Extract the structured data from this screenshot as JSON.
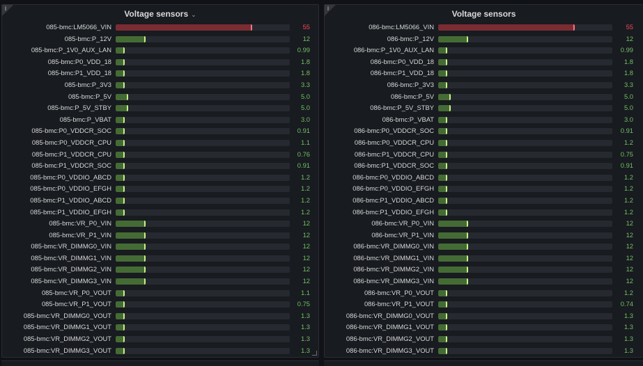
{
  "colors": {
    "ok": "#73bf69",
    "critical": "#f2495c",
    "bar_ok": "#456b35",
    "bar_critical": "#7a2c33"
  },
  "bar_max": 70,
  "panels": [
    {
      "title": "Voltage sensors",
      "has_menu": true,
      "info_icon": "i",
      "rows": [
        {
          "label": "085-bmc:LM5066_VIN",
          "value": "55",
          "status": "critical"
        },
        {
          "label": "085-bmc:P_12V",
          "value": "12",
          "status": "ok"
        },
        {
          "label": "085-bmc:P_1V0_AUX_LAN",
          "value": "0.99",
          "status": "ok"
        },
        {
          "label": "085-bmc:P0_VDD_18",
          "value": "1.8",
          "status": "ok"
        },
        {
          "label": "085-bmc:P1_VDD_18",
          "value": "1.8",
          "status": "ok"
        },
        {
          "label": "085-bmc:P_3V3",
          "value": "3.3",
          "status": "ok"
        },
        {
          "label": "085-bmc:P_5V",
          "value": "5.0",
          "status": "ok"
        },
        {
          "label": "085-bmc:P_5V_STBY",
          "value": "5.0",
          "status": "ok"
        },
        {
          "label": "085-bmc:P_VBAT",
          "value": "3.0",
          "status": "ok"
        },
        {
          "label": "085-bmc:P0_VDDCR_SOC",
          "value": "0.91",
          "status": "ok"
        },
        {
          "label": "085-bmc:P0_VDDCR_CPU",
          "value": "1.1",
          "status": "ok"
        },
        {
          "label": "085-bmc:P1_VDDCR_CPU",
          "value": "0.76",
          "status": "ok"
        },
        {
          "label": "085-bmc:P1_VDDCR_SOC",
          "value": "0.91",
          "status": "ok"
        },
        {
          "label": "085-bmc:P0_VDDIO_ABCD",
          "value": "1.2",
          "status": "ok"
        },
        {
          "label": "085-bmc:P0_VDDIO_EFGH",
          "value": "1.2",
          "status": "ok"
        },
        {
          "label": "085-bmc:P1_VDDIO_ABCD",
          "value": "1.2",
          "status": "ok"
        },
        {
          "label": "085-bmc:P1_VDDIO_EFGH",
          "value": "1.2",
          "status": "ok"
        },
        {
          "label": "085-bmc:VR_P0_VIN",
          "value": "12",
          "status": "ok"
        },
        {
          "label": "085-bmc:VR_P1_VIN",
          "value": "12",
          "status": "ok"
        },
        {
          "label": "085-bmc:VR_DIMMG0_VIN",
          "value": "12",
          "status": "ok"
        },
        {
          "label": "085-bmc:VR_DIMMG1_VIN",
          "value": "12",
          "status": "ok"
        },
        {
          "label": "085-bmc:VR_DIMMG2_VIN",
          "value": "12",
          "status": "ok"
        },
        {
          "label": "085-bmc:VR_DIMMG3_VIN",
          "value": "12",
          "status": "ok"
        },
        {
          "label": "085-bmc:VR_P0_VOUT",
          "value": "1.1",
          "status": "ok"
        },
        {
          "label": "085-bmc:VR_P1_VOUT",
          "value": "0.75",
          "status": "ok"
        },
        {
          "label": "085-bmc:VR_DIMMG0_VOUT",
          "value": "1.3",
          "status": "ok"
        },
        {
          "label": "085-bmc:VR_DIMMG1_VOUT",
          "value": "1.3",
          "status": "ok"
        },
        {
          "label": "085-bmc:VR_DIMMG2_VOUT",
          "value": "1.3",
          "status": "ok"
        },
        {
          "label": "085-bmc:VR_DIMMG3_VOUT",
          "value": "1.3",
          "status": "ok"
        }
      ]
    },
    {
      "title": "Voltage sensors",
      "has_menu": false,
      "info_icon": "i",
      "rows": [
        {
          "label": "086-bmc:LM5066_VIN",
          "value": "55",
          "status": "critical"
        },
        {
          "label": "086-bmc:P_12V",
          "value": "12",
          "status": "ok"
        },
        {
          "label": "086-bmc:P_1V0_AUX_LAN",
          "value": "0.99",
          "status": "ok"
        },
        {
          "label": "086-bmc:P0_VDD_18",
          "value": "1.8",
          "status": "ok"
        },
        {
          "label": "086-bmc:P1_VDD_18",
          "value": "1.8",
          "status": "ok"
        },
        {
          "label": "086-bmc:P_3V3",
          "value": "3.3",
          "status": "ok"
        },
        {
          "label": "086-bmc:P_5V",
          "value": "5.0",
          "status": "ok"
        },
        {
          "label": "086-bmc:P_5V_STBY",
          "value": "5.0",
          "status": "ok"
        },
        {
          "label": "086-bmc:P_VBAT",
          "value": "3.0",
          "status": "ok"
        },
        {
          "label": "086-bmc:P0_VDDCR_SOC",
          "value": "0.91",
          "status": "ok"
        },
        {
          "label": "086-bmc:P0_VDDCR_CPU",
          "value": "1.2",
          "status": "ok"
        },
        {
          "label": "086-bmc:P1_VDDCR_CPU",
          "value": "0.75",
          "status": "ok"
        },
        {
          "label": "086-bmc:P1_VDDCR_SOC",
          "value": "0.91",
          "status": "ok"
        },
        {
          "label": "086-bmc:P0_VDDIO_ABCD",
          "value": "1.2",
          "status": "ok"
        },
        {
          "label": "086-bmc:P0_VDDIO_EFGH",
          "value": "1.2",
          "status": "ok"
        },
        {
          "label": "086-bmc:P1_VDDIO_ABCD",
          "value": "1.2",
          "status": "ok"
        },
        {
          "label": "086-bmc:P1_VDDIO_EFGH",
          "value": "1.2",
          "status": "ok"
        },
        {
          "label": "086-bmc:VR_P0_VIN",
          "value": "12",
          "status": "ok"
        },
        {
          "label": "086-bmc:VR_P1_VIN",
          "value": "12",
          "status": "ok"
        },
        {
          "label": "086-bmc:VR_DIMMG0_VIN",
          "value": "12",
          "status": "ok"
        },
        {
          "label": "086-bmc:VR_DIMMG1_VIN",
          "value": "12",
          "status": "ok"
        },
        {
          "label": "086-bmc:VR_DIMMG2_VIN",
          "value": "12",
          "status": "ok"
        },
        {
          "label": "086-bmc:VR_DIMMG3_VIN",
          "value": "12",
          "status": "ok"
        },
        {
          "label": "086-bmc:VR_P0_VOUT",
          "value": "1.2",
          "status": "ok"
        },
        {
          "label": "086-bmc:VR_P1_VOUT",
          "value": "0.74",
          "status": "ok"
        },
        {
          "label": "086-bmc:VR_DIMMG0_VOUT",
          "value": "1.3",
          "status": "ok"
        },
        {
          "label": "086-bmc:VR_DIMMG1_VOUT",
          "value": "1.3",
          "status": "ok"
        },
        {
          "label": "086-bmc:VR_DIMMG2_VOUT",
          "value": "1.3",
          "status": "ok"
        },
        {
          "label": "086-bmc:VR_DIMMG3_VOUT",
          "value": "1.3",
          "status": "ok"
        }
      ]
    }
  ]
}
